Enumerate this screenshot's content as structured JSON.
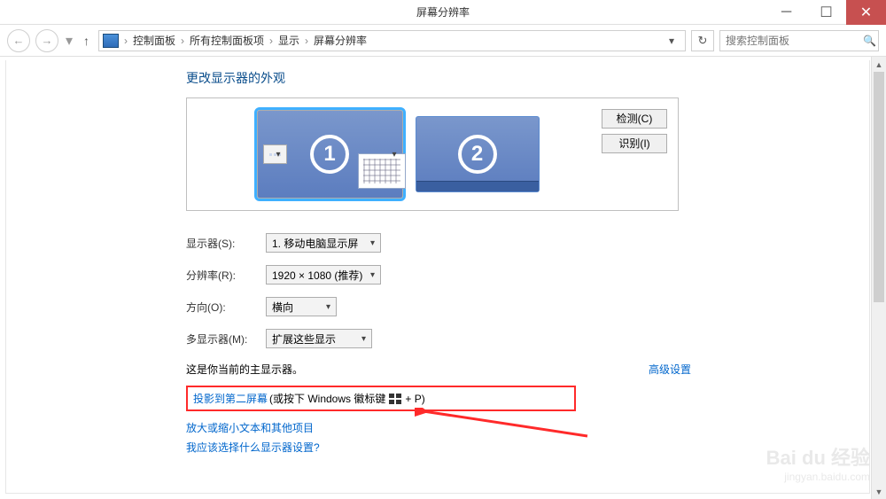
{
  "window": {
    "title": "屏幕分辨率"
  },
  "breadcrumb": {
    "items": [
      "控制面板",
      "所有控制面板项",
      "显示",
      "屏幕分辨率"
    ]
  },
  "search": {
    "placeholder": "搜索控制面板"
  },
  "page": {
    "title": "更改显示器的外观"
  },
  "monitors": {
    "display1_num": "1",
    "display2_num": "2"
  },
  "panel_buttons": {
    "detect": "检测(C)",
    "identify": "识别(I)"
  },
  "form": {
    "display_label": "显示器(S):",
    "display_value": "1. 移动电脑显示屏",
    "resolution_label": "分辨率(R):",
    "resolution_value": "1920 × 1080 (推荐)",
    "orientation_label": "方向(O):",
    "orientation_value": "横向",
    "multi_label": "多显示器(M):",
    "multi_value": "扩展这些显示"
  },
  "status": {
    "text": "这是你当前的主显示器。",
    "advanced_link": "高级设置"
  },
  "project": {
    "link": "投影到第二屏幕",
    "hint_pre": " (或按下 Windows 徽标键 ",
    "hint_post": " + P)"
  },
  "links": {
    "resize_text": "放大或缩小文本和其他项目",
    "which_display": "我应该选择什么显示器设置?"
  },
  "watermark": {
    "brand": "Bai du 经验",
    "url": "jingyan.baidu.com"
  }
}
